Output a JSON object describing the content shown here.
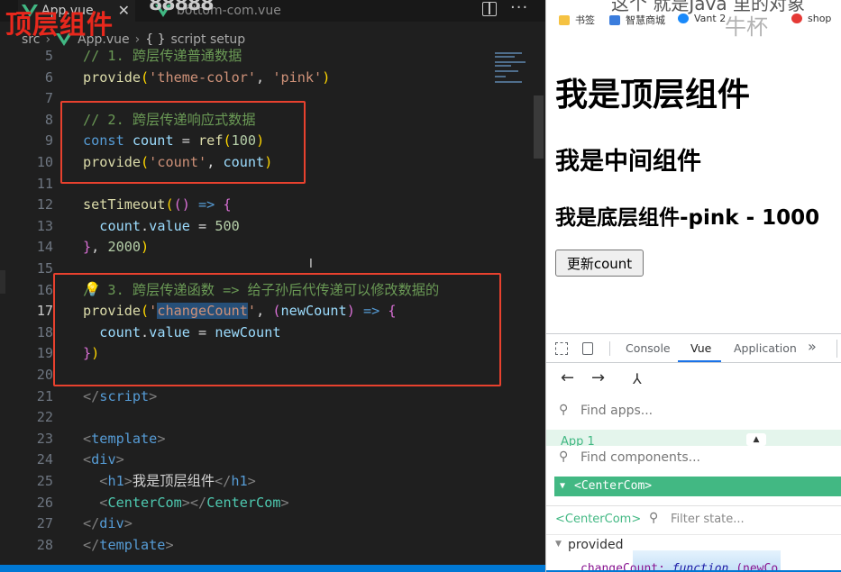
{
  "editor": {
    "overlay_title": "顶层组件",
    "tabs": [
      {
        "label": "App.vue",
        "close": "✕"
      },
      {
        "label": "bottom-com.vue"
      }
    ],
    "tab_hint": "88888",
    "breadcrumb": {
      "src": "src",
      "sep": "›",
      "file": "App.vue",
      "braces": "{ }",
      "scope": "script setup"
    },
    "active_line": 17,
    "lines": [
      {
        "n": "5",
        "segs": [
          [
            "c-cmt",
            "// 1. 跨层传递普通数据"
          ]
        ]
      },
      {
        "n": "6",
        "segs": [
          [
            "c-fn",
            "provide"
          ],
          [
            "c-br1",
            "("
          ],
          [
            "c-str",
            "'theme-color'"
          ],
          [
            "c-plain",
            ", "
          ],
          [
            "c-str",
            "'pink'"
          ],
          [
            "c-br1",
            ")"
          ]
        ]
      },
      {
        "n": "7",
        "segs": []
      },
      {
        "n": "8",
        "segs": [
          [
            "c-cmt",
            "// 2. 跨层传递响应式数据"
          ]
        ]
      },
      {
        "n": "9",
        "segs": [
          [
            "c-kw",
            "const "
          ],
          [
            "c-var",
            "count"
          ],
          [
            "c-plain",
            " = "
          ],
          [
            "c-fn",
            "ref"
          ],
          [
            "c-br1",
            "("
          ],
          [
            "c-num",
            "100"
          ],
          [
            "c-br1",
            ")"
          ]
        ]
      },
      {
        "n": "10",
        "segs": [
          [
            "c-fn",
            "provide"
          ],
          [
            "c-br1",
            "("
          ],
          [
            "c-str",
            "'count'"
          ],
          [
            "c-plain",
            ", "
          ],
          [
            "c-var",
            "count"
          ],
          [
            "c-br1",
            ")"
          ]
        ]
      },
      {
        "n": "11",
        "segs": []
      },
      {
        "n": "12",
        "segs": [
          [
            "c-fn",
            "setTimeout"
          ],
          [
            "c-br1",
            "("
          ],
          [
            "c-br2",
            "()"
          ],
          [
            "c-kw",
            " => "
          ],
          [
            "c-br2",
            "{"
          ]
        ]
      },
      {
        "n": "13",
        "segs": [
          [
            "c-plain",
            "  "
          ],
          [
            "c-var",
            "count"
          ],
          [
            "c-plain",
            "."
          ],
          [
            "c-var",
            "value"
          ],
          [
            "c-plain",
            " = "
          ],
          [
            "c-num",
            "500"
          ]
        ]
      },
      {
        "n": "14",
        "segs": [
          [
            "c-br2",
            "}"
          ],
          [
            "c-plain",
            ", "
          ],
          [
            "c-num",
            "2000"
          ],
          [
            "c-br1",
            ")"
          ]
        ]
      },
      {
        "n": "15",
        "segs": []
      },
      {
        "n": "16",
        "segs": [
          [
            "c-cmt",
            "// 3. 跨层传递函数 => 给子孙后代传递可以修改数据的"
          ]
        ]
      },
      {
        "n": "17",
        "segs": [
          [
            "c-fn",
            "provide"
          ],
          [
            "c-br1",
            "("
          ],
          [
            "c-str",
            "'"
          ],
          [
            "c-str c-sel",
            "changeCount"
          ],
          [
            "c-str",
            "'"
          ],
          [
            "c-plain",
            ", "
          ],
          [
            "c-br2",
            "("
          ],
          [
            "c-var",
            "newCount"
          ],
          [
            "c-br2",
            ")"
          ],
          [
            "c-kw",
            " => "
          ],
          [
            "c-br2",
            "{"
          ]
        ]
      },
      {
        "n": "18",
        "segs": [
          [
            "c-plain",
            "  "
          ],
          [
            "c-var",
            "count"
          ],
          [
            "c-plain",
            "."
          ],
          [
            "c-var",
            "value"
          ],
          [
            "c-plain",
            " = "
          ],
          [
            "c-var",
            "newCount"
          ]
        ]
      },
      {
        "n": "19",
        "segs": [
          [
            "c-br2",
            "}"
          ],
          [
            "c-br1",
            ")"
          ]
        ]
      },
      {
        "n": "20",
        "segs": []
      },
      {
        "n": "21",
        "segs": [
          [
            "c-tagp",
            "</"
          ],
          [
            "c-tag",
            "script"
          ],
          [
            "c-tagp",
            ">"
          ]
        ]
      },
      {
        "n": "22",
        "segs": []
      },
      {
        "n": "23",
        "segs": [
          [
            "c-tagp",
            "<"
          ],
          [
            "c-tag",
            "template"
          ],
          [
            "c-tagp",
            ">"
          ]
        ]
      },
      {
        "n": "24",
        "segs": [
          [
            "c-tagp",
            "<"
          ],
          [
            "c-tag",
            "div"
          ],
          [
            "c-tagp",
            ">"
          ]
        ]
      },
      {
        "n": "25",
        "segs": [
          [
            "c-plain",
            "  "
          ],
          [
            "c-tagp",
            "<"
          ],
          [
            "c-tag",
            "h1"
          ],
          [
            "c-tagp",
            ">"
          ],
          [
            "c-plain",
            "我是顶层组件"
          ],
          [
            "c-tagp",
            "</"
          ],
          [
            "c-tag",
            "h1"
          ],
          [
            "c-tagp",
            ">"
          ]
        ]
      },
      {
        "n": "26",
        "segs": [
          [
            "c-plain",
            "  "
          ],
          [
            "c-tagp",
            "<"
          ],
          [
            "c-comp",
            "CenterCom"
          ],
          [
            "c-tagp",
            "></"
          ],
          [
            "c-comp",
            "CenterCom"
          ],
          [
            "c-tagp",
            ">"
          ]
        ]
      },
      {
        "n": "27",
        "segs": [
          [
            "c-tagp",
            "</"
          ],
          [
            "c-tag",
            "div"
          ],
          [
            "c-tagp",
            ">"
          ]
        ]
      },
      {
        "n": "28",
        "segs": [
          [
            "c-tagp",
            "</"
          ],
          [
            "c-tag",
            "template"
          ],
          [
            "c-tagp",
            ">"
          ]
        ]
      }
    ],
    "bulb_icon": "💡"
  },
  "browser": {
    "page_title_fragment": "这个 就是Java 里的对象",
    "cup_overlay": "牛杯",
    "bookmarks": [
      "书签",
      "智慧商城",
      "Vant 2",
      "shop"
    ],
    "page": {
      "h1": "我是顶层组件",
      "h2": "我是中间组件",
      "h3": "我是底层组件-pink - 1000",
      "button": "更新count"
    }
  },
  "devtools": {
    "tabs": [
      "Console",
      "Vue",
      "Application",
      "»"
    ],
    "active_tab": "Vue",
    "nav": {
      "back": "←",
      "forward": "→",
      "tree": "⅄"
    },
    "find_apps_placeholder": "Find apps...",
    "app_row": "App 1",
    "find_components_placeholder": "Find components...",
    "selected_component": "<CenterCom>",
    "state_component": "<CenterCom>",
    "filter_state_placeholder": "Filter state...",
    "provided_label": "provided",
    "provided_key": "changeCount:",
    "provided_value": "function",
    "provided_args": "(newCo"
  }
}
